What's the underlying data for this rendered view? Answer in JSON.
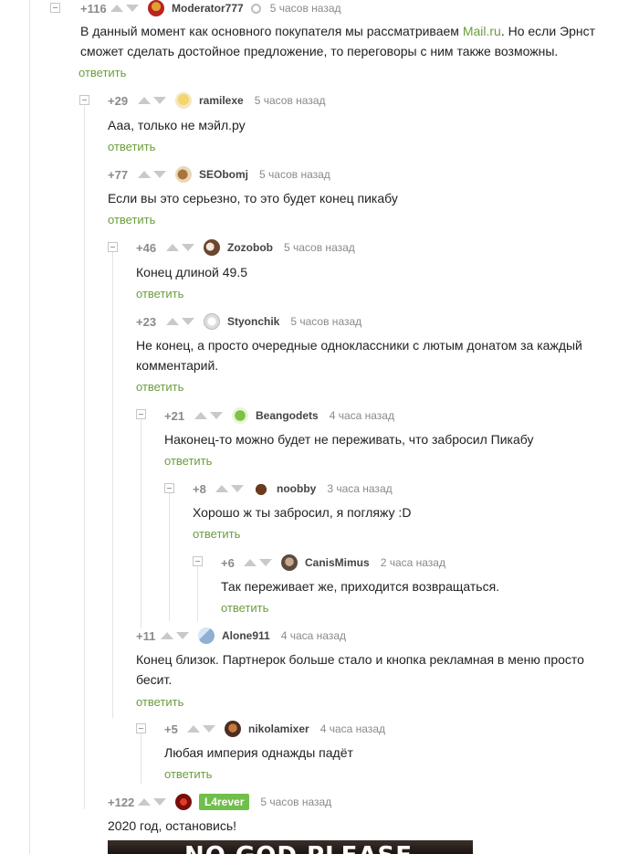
{
  "reply_label": "ответить",
  "comments": [
    {
      "rating": "+116",
      "author": "Moderator777",
      "time": "5 часов назад",
      "text_before": "В данный момент как основного покупателя мы рассматриваем ",
      "link_text": "Mail.ru",
      "text_after": ". Но если Эрнст сможет сделать достойное предложение, то переговоры с ним также возможны.",
      "avatar_icon": "moderator-avatar-icon"
    },
    {
      "rating": "+29",
      "author": "ramilexe",
      "time": "5 часов назад",
      "text": "Ааа, только не мэйл.ру"
    },
    {
      "rating": "+77",
      "author": "SEObomj",
      "time": "5 часов назад",
      "text": "Если вы это серьезно, то это будет конец пикабу"
    },
    {
      "rating": "+46",
      "author": "Zozobob",
      "time": "5 часов назад",
      "text": "Конец длиной 49.5"
    },
    {
      "rating": "+23",
      "author": "Styonchik",
      "time": "5 часов назад",
      "text": "Не конец, а просто очередные одноклассники с лютым донатом за каждый комментарий."
    },
    {
      "rating": "+21",
      "author": "Beangodets",
      "time": "4 часа назад",
      "text": "Наконец-то можно будет не переживать, что забросил Пикабу"
    },
    {
      "rating": "+8",
      "author": "noobby",
      "time": "3 часа назад",
      "text": "Хорошо ж ты забросил, я погляжу :D"
    },
    {
      "rating": "+6",
      "author": "CanisMimus",
      "time": "2 часа назад",
      "text": "Так переживает же, приходится возвращаться."
    },
    {
      "rating": "+11",
      "author": "Alone911",
      "time": "4 часа назад",
      "text": "Конец близок. Партнерок больше стало и кнопка рекламная в меню просто бесит."
    },
    {
      "rating": "+5",
      "author": "nikolamixer",
      "time": "4 часа назад",
      "text": "Любая империя однажды падёт"
    },
    {
      "rating": "+122",
      "author": "L4rever",
      "time": "5 часов назад",
      "text": "2020 год, остановись!"
    }
  ],
  "meme_caption": "NO GOD PLEASE",
  "colors": {
    "accent": "#6b9e3c",
    "badge": "#6fbf4a",
    "muted": "#8a8a8a"
  }
}
